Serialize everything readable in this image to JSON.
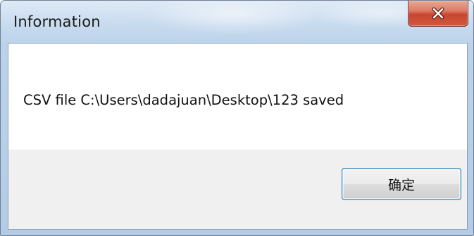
{
  "window": {
    "title": "Information",
    "close_icon": "close-icon"
  },
  "dialog": {
    "message": "CSV file C:\\Users\\dadajuan\\Desktop\\123 saved",
    "ok_label": "确定"
  },
  "colors": {
    "close_button": "#c8452f",
    "ok_border": "#3c7fb1",
    "content_bg": "#ffffff",
    "footer_bg": "#f0f0f0"
  }
}
